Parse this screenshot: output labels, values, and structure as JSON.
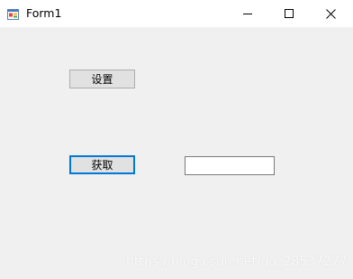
{
  "window": {
    "title": "Form1"
  },
  "titlebar": {
    "icons": {
      "app": "form-app-icon",
      "minimize": "minimize-icon",
      "maximize": "maximize-icon",
      "close": "close-icon"
    }
  },
  "form": {
    "settings_button_label": "设置",
    "get_button_label": "获取",
    "textbox_value": ""
  },
  "watermark": {
    "text": "https://blog.csdn.net/qq_28537277"
  },
  "colors": {
    "focus_border": "#0078d7",
    "client_background": "#f0f0f0"
  }
}
